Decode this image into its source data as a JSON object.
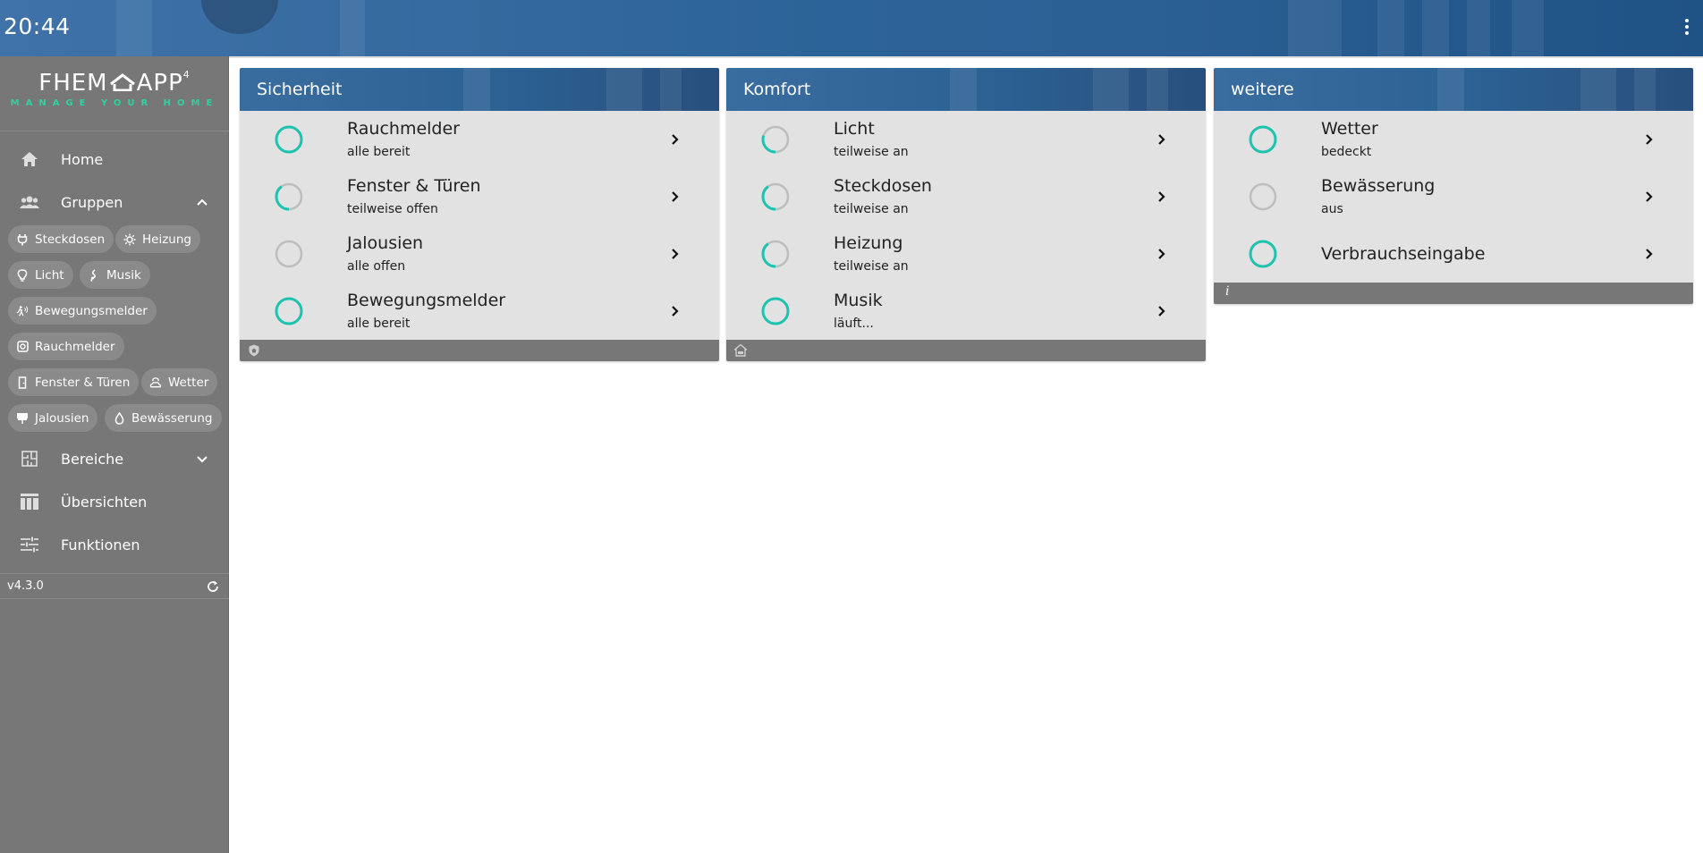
{
  "header": {
    "clock": "20:44",
    "menu_icon": "more-vertical-icon"
  },
  "sidebar": {
    "logo": {
      "main": "FHEM",
      "app": "APP",
      "superscript": "4",
      "tagline": "MANAGE YOUR HOME"
    },
    "nav": {
      "home": {
        "label": "Home",
        "icon": "home-icon"
      },
      "gruppen": {
        "label": "Gruppen",
        "icon": "groups-icon",
        "expanded": true
      },
      "bereiche": {
        "label": "Bereiche",
        "icon": "floorplan-icon",
        "expanded": false
      },
      "uebersichten": {
        "label": "Übersichten",
        "icon": "dashboard-icon"
      },
      "funktionen": {
        "label": "Funktionen",
        "icon": "tune-icon"
      }
    },
    "chips": [
      {
        "label": "Steckdosen",
        "icon": "plug-icon"
      },
      {
        "label": "Heizung",
        "icon": "heating-icon"
      },
      {
        "label": "Licht",
        "icon": "bulb-icon"
      },
      {
        "label": "Musik",
        "icon": "music-icon"
      },
      {
        "label": "Bewegungsmelder",
        "icon": "motion-icon"
      },
      {
        "label": "Rauchmelder",
        "icon": "smoke-detector-icon"
      },
      {
        "label": "Fenster & Türen",
        "icon": "door-icon"
      },
      {
        "label": "Wetter",
        "icon": "weather-icon"
      },
      {
        "label": "Jalousien",
        "icon": "blinds-icon"
      },
      {
        "label": "Bewässerung",
        "icon": "water-drop-icon"
      }
    ],
    "version": "v4.3.0"
  },
  "colors": {
    "accent": "#1ec2ae",
    "ring_track": "#bdbdbd",
    "sidebar": "#777777",
    "card": "#e2e2e2"
  },
  "cards": [
    {
      "title": "Sicherheit",
      "footer_icon": "shield-home-icon",
      "rows": [
        {
          "name": "Rauchmelder",
          "status": "alle bereit",
          "level": 1.0
        },
        {
          "name": "Fenster & Türen",
          "status": "teilweise offen",
          "level": 0.4
        },
        {
          "name": "Jalousien",
          "status": "alle offen",
          "level": 0.0
        },
        {
          "name": "Bewegungsmelder",
          "status": "alle bereit",
          "level": 1.0
        }
      ]
    },
    {
      "title": "Komfort",
      "footer_icon": "sofa-home-icon",
      "rows": [
        {
          "name": "Licht",
          "status": "teilweise an",
          "level": 0.3
        },
        {
          "name": "Steckdosen",
          "status": "teilweise an",
          "level": 0.4
        },
        {
          "name": "Heizung",
          "status": "teilweise an",
          "level": 0.4
        },
        {
          "name": "Musik",
          "status": "läuft...",
          "level": 1.0
        }
      ]
    },
    {
      "title": "weitere",
      "footer_text": "i",
      "rows": [
        {
          "name": "Wetter",
          "status": "bedeckt",
          "level": 1.0
        },
        {
          "name": "Bewässerung",
          "status": "aus",
          "level": 0.0
        },
        {
          "name": "Verbrauchseingabe",
          "status": "",
          "level": 1.0
        }
      ]
    }
  ]
}
